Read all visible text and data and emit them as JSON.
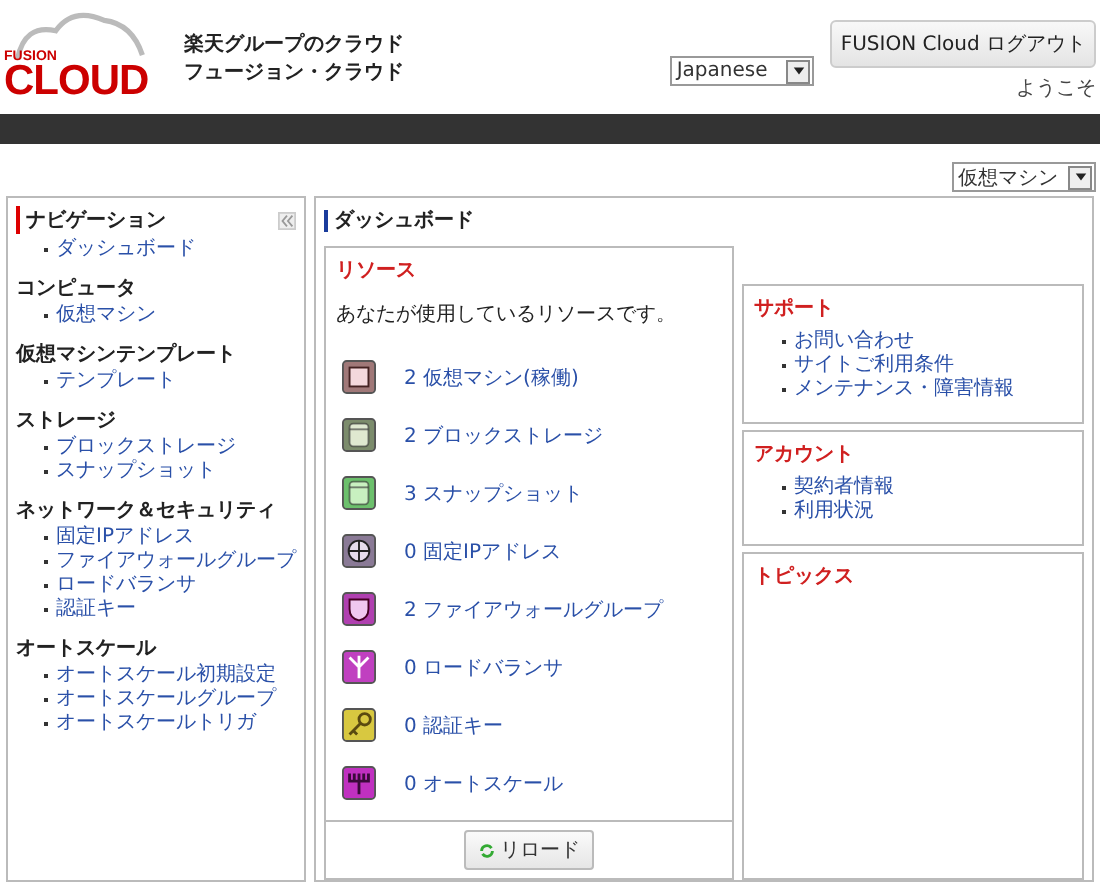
{
  "header": {
    "logo_top": "FUSION",
    "logo_main": "CLOUD",
    "title": "楽天グループのクラウド",
    "subtitle": "フュージョン・クラウド",
    "language": "Japanese",
    "logout": "FUSION Cloud ログアウト",
    "welcome": "ようこそ"
  },
  "view_select": "仮想マシン",
  "sidebar": {
    "title": "ナビゲーション",
    "sections": [
      {
        "items": [
          "ダッシュボード"
        ]
      },
      {
        "heading": "コンピュータ",
        "items": [
          "仮想マシン"
        ]
      },
      {
        "heading": "仮想マシンテンプレート",
        "items": [
          "テンプレート"
        ]
      },
      {
        "heading": "ストレージ",
        "items": [
          "ブロックストレージ",
          "スナップショット"
        ]
      },
      {
        "heading": "ネットワーク＆セキュリティ",
        "items": [
          "固定IPアドレス",
          "ファイアウォールグループ",
          "ロードバランサ",
          "認証キー"
        ]
      },
      {
        "heading": "オートスケール",
        "items": [
          "オートスケール初期設定",
          "オートスケールグループ",
          "オートスケールトリガ"
        ]
      }
    ]
  },
  "dashboard": {
    "title": "ダッシュボード",
    "resources": {
      "title": "リソース",
      "intro": "あなたが使用しているリソースです。",
      "items": [
        {
          "kind": "vm",
          "label": "2 仮想マシン(稼働)"
        },
        {
          "kind": "block",
          "label": "2 ブロックストレージ"
        },
        {
          "kind": "snapshot",
          "label": "3 スナップショット"
        },
        {
          "kind": "ip",
          "label": "0 固定IPアドレス"
        },
        {
          "kind": "firewall",
          "label": "2 ファイアウォールグループ"
        },
        {
          "kind": "lb",
          "label": "0 ロードバランサ"
        },
        {
          "kind": "key",
          "label": "0 認証キー"
        },
        {
          "kind": "autoscale",
          "label": "0 オートスケール"
        }
      ],
      "reload": "リロード"
    },
    "support": {
      "title": "サポート",
      "items": [
        "お問い合わせ",
        "サイトご利用条件",
        "メンテナンス・障害情報"
      ]
    },
    "account": {
      "title": "アカウント",
      "items": [
        "契約者情報",
        "利用状況"
      ]
    },
    "topics": {
      "title": "トピックス"
    }
  }
}
